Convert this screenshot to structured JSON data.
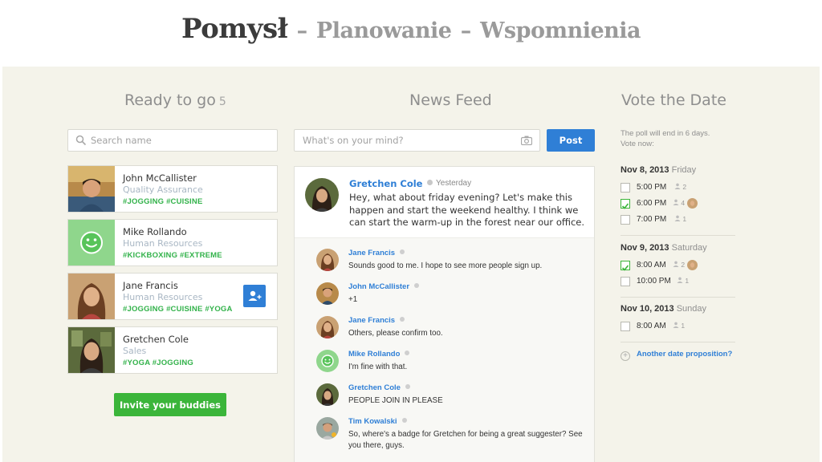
{
  "slide": {
    "title_main": "Pomysł",
    "separator": "–",
    "title_second": "Planowanie",
    "title_third": "Wspomnienia"
  },
  "ready": {
    "title": "Ready to go",
    "count": "5",
    "search_placeholder": "Search name",
    "invite_label": "Invite your buddies",
    "people": [
      {
        "name": "John McCallister",
        "role": "Quality Assurance",
        "tags": "#JOGGING #CUISINE"
      },
      {
        "name": "Mike Rollando",
        "role": "Human Resources",
        "tags": "#KICKBOXING #EXTREME"
      },
      {
        "name": "Jane Francis",
        "role": "Human Resources",
        "tags": "#JOGGING #CUISINE #YOGA"
      },
      {
        "name": "Gretchen Cole",
        "role": "Sales",
        "tags": "#YOGA #JOGGING"
      }
    ]
  },
  "feed": {
    "title": "News Feed",
    "compose_placeholder": "What's on your mind?",
    "post_label": "Post",
    "post": {
      "author": "Gretchen Cole",
      "time": "Yesterday",
      "text": "Hey, what about friday evening? Let's make this happen and start the weekend healthy. I think we can start the warm-up in the forest near our office."
    },
    "comments": [
      {
        "author": "Jane Francis",
        "text": "Sounds good to me. I hope to see more people sign up."
      },
      {
        "author": "John McCallister",
        "text": "+1"
      },
      {
        "author": "Jane Francis",
        "text": "Others, please confirm too."
      },
      {
        "author": "Mike Rollando",
        "text": "I'm fine with that."
      },
      {
        "author": "Gretchen Cole",
        "text": "PEOPLE JOIN IN PLEASE"
      },
      {
        "author": "Tim Kowalski",
        "text": "So, where's a badge for Gretchen for being a great suggester? See you there, guys."
      }
    ]
  },
  "vote": {
    "title": "Vote the Date",
    "poll_line1": "The poll will end in 6 days.",
    "poll_line2": "Vote now:",
    "another_label": "Another date proposition?",
    "dates": [
      {
        "date": "Nov 8, 2013",
        "dow": "Friday",
        "options": [
          {
            "time": "5:00 PM",
            "votes": "2",
            "checked": false
          },
          {
            "time": "6:00 PM",
            "votes": "4",
            "checked": true
          },
          {
            "time": "7:00 PM",
            "votes": "1",
            "checked": false
          }
        ]
      },
      {
        "date": "Nov 9, 2013",
        "dow": "Saturday",
        "options": [
          {
            "time": "8:00 AM",
            "votes": "2",
            "checked": true
          },
          {
            "time": "10:00 PM",
            "votes": "1",
            "checked": false
          }
        ]
      },
      {
        "date": "Nov 10, 2013",
        "dow": "Sunday",
        "options": [
          {
            "time": "8:00 AM",
            "votes": "1",
            "checked": false
          }
        ]
      }
    ]
  },
  "colors": {
    "accent_blue": "#2f7fd6",
    "accent_green": "#3bb53a",
    "background": "#f4f3ea"
  }
}
